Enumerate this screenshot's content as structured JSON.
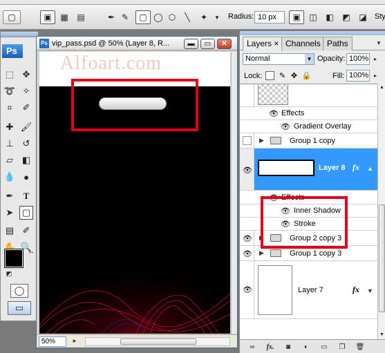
{
  "watermark": "Alfoart.com",
  "options": {
    "radius_label": "Radius:",
    "radius_value": "10 px",
    "style_label": "Sty"
  },
  "tools": {
    "logo": "Ps"
  },
  "document": {
    "title": "vip_pass.psd @ 50% (Layer 8, R...",
    "zoom": "50%"
  },
  "layers_panel": {
    "tabs": [
      {
        "label": "Layers",
        "close": "×"
      },
      {
        "label": "Channels"
      },
      {
        "label": "Paths"
      }
    ],
    "blend_mode": "Normal",
    "opacity_label": "Opacity:",
    "opacity_value": "100%",
    "lock_label": "Lock:",
    "fill_label": "Fill:",
    "fill_value": "100%",
    "rows": [
      {
        "name": "Effects"
      },
      {
        "name": "Gradient Overlay"
      },
      {
        "name": "Group 1 copy"
      },
      {
        "name": "Layer 8",
        "fx": "fx"
      },
      {
        "name": "Effects"
      },
      {
        "name": "Inner Shadow"
      },
      {
        "name": "Stroke"
      },
      {
        "name": "Group 2 copy 3"
      },
      {
        "name": "Group 1 copy 3"
      },
      {
        "name": "Layer 7",
        "fx": "fx"
      }
    ],
    "bottom_fx": "fx."
  },
  "colors": {
    "selection": "#3399ff",
    "highlight_box": "#e0001a",
    "foreground": "#000000",
    "background": "#ffffff"
  }
}
